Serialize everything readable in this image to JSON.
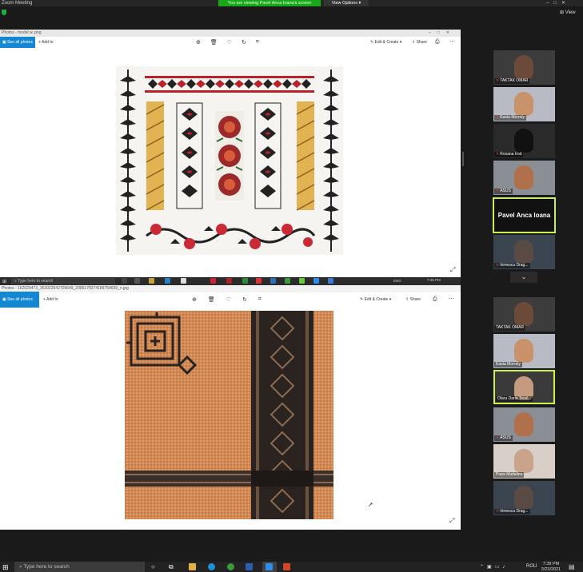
{
  "app_title": "Zoom Meeting",
  "share_banner": "You are viewing Pavel Anca Ioana's screen",
  "view_options": "View Options",
  "view_button": "View",
  "window1": {
    "title": "Photos - model w..png",
    "see_all": "See all photos",
    "add_to": "Add to",
    "edit_create": "Edit & Create",
    "share": "Share"
  },
  "window2": {
    "title": "Photos - 162029473_353922642709649_2085178274189754659_n.jpg",
    "see_all": "See all photos",
    "add_to": "Add to",
    "edit_create": "Edit & Create",
    "share": "Share"
  },
  "taskbar_inner": {
    "search": "Type here to search",
    "lang": "ENG",
    "time": "7:35 PM"
  },
  "taskbar": {
    "search": "Type here to search",
    "lang": "ROU",
    "time": "7:39 PM",
    "date": "3/23/2021"
  },
  "speaker": "Pavel Anca Ioana",
  "participants_top": [
    {
      "name": "TAKTAK OMAR"
    },
    {
      "name": "Kasta Morrely"
    },
    {
      "name": "Roxana Irod"
    },
    {
      "name": "ASUS"
    },
    {
      "name": "Irimescu Drag..."
    }
  ],
  "participants_bottom": [
    {
      "name": "TAKTAK OMAR"
    },
    {
      "name": "Kasta Morrely"
    },
    {
      "name": "Olaru Daria Teod..."
    },
    {
      "name": "ASUS"
    },
    {
      "name": "Popa Madalina"
    },
    {
      "name": "Irimescu Drag..."
    }
  ],
  "colors": {
    "share_green": "#18a81a",
    "active_border": "#c9f04c",
    "photos_blue": "#1487d2"
  }
}
